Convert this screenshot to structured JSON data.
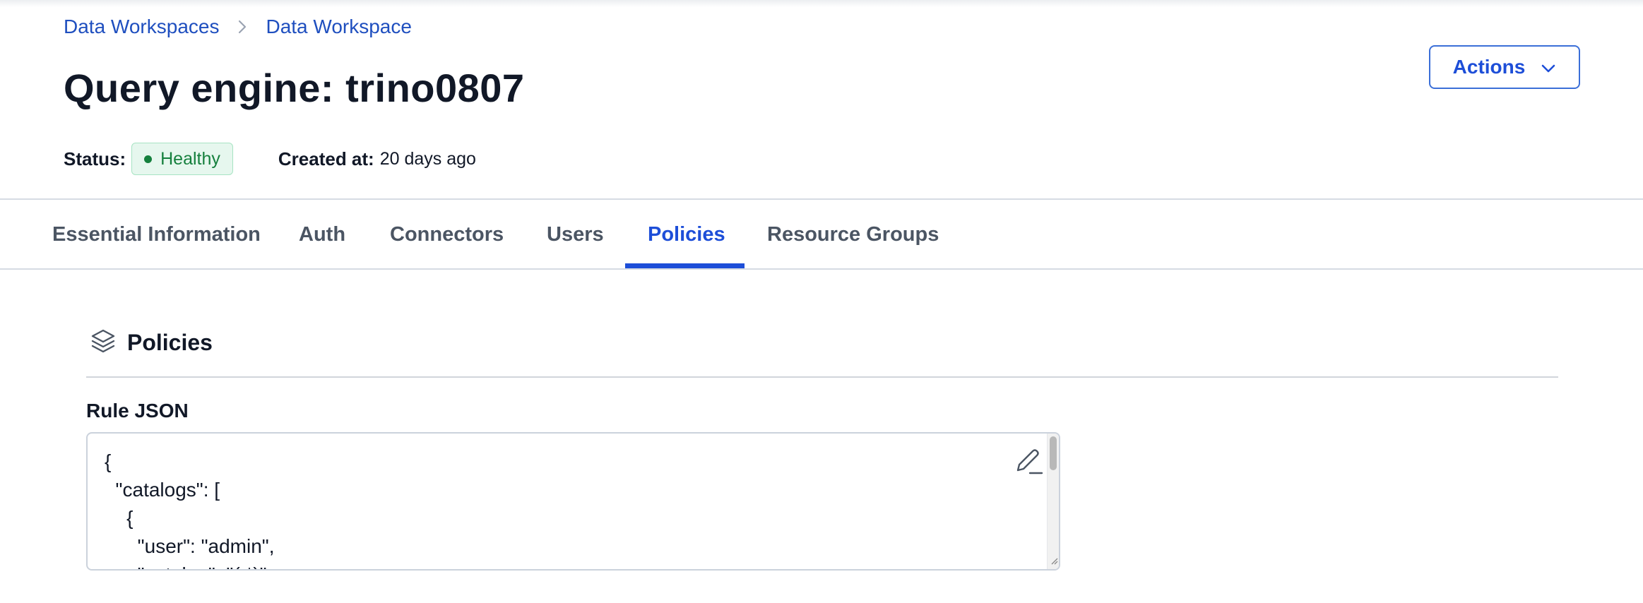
{
  "breadcrumb": {
    "items": [
      "Data Workspaces",
      "Data Workspace"
    ],
    "separator_icon": "chevron-right-icon"
  },
  "page": {
    "title": "Query engine: trino0807"
  },
  "header_actions": {
    "label": "Actions",
    "icon": "chevron-down-icon"
  },
  "meta": {
    "status_label": "Status:",
    "status_value": "Healthy",
    "status_color": "#15803d",
    "created_label": "Created at:",
    "created_value": "20 days ago"
  },
  "tabs": [
    {
      "label": "Essential Information",
      "active": false
    },
    {
      "label": "Auth",
      "active": false
    },
    {
      "label": "Connectors",
      "active": false
    },
    {
      "label": "Users",
      "active": false
    },
    {
      "label": "Policies",
      "active": true
    },
    {
      "label": "Resource Groups",
      "active": false
    }
  ],
  "section": {
    "title": "Policies",
    "icon": "layers-icon"
  },
  "rule_json": {
    "label": "Rule JSON",
    "lines": [
      "{",
      "  \"catalogs\": [",
      "    {",
      "      \"user\": \"admin\",",
      "      \"catalog\": \"(.*)\","
    ],
    "edit_icon": "edit-icon"
  },
  "colors": {
    "accent": "#1d4ed8",
    "healthy_bg": "#e6f7ee",
    "healthy_border": "#a7e4c3"
  }
}
